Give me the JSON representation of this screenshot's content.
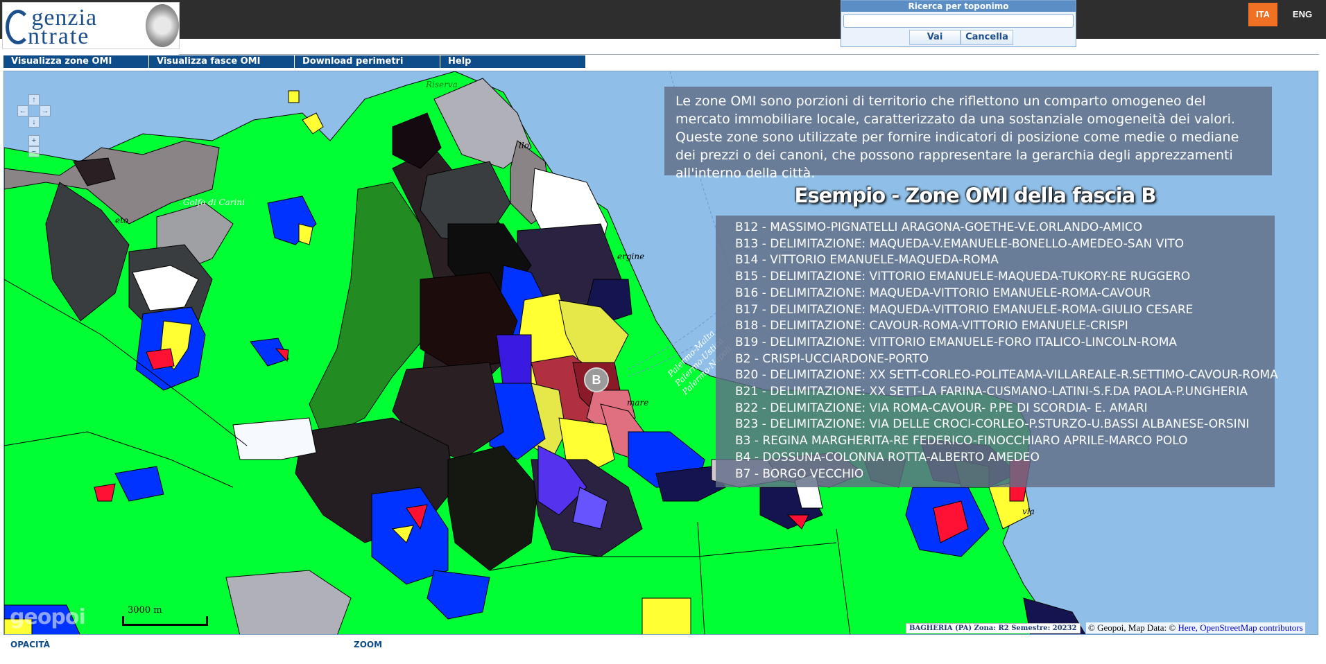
{
  "header": {
    "logo_line1": "genzia",
    "logo_line2": "ntrate",
    "logo_alt": "Agenzia Entrate"
  },
  "search": {
    "title": "Ricerca per toponimo",
    "input_value": "",
    "go_label": "Vai",
    "cancel_label": "Cancella"
  },
  "lang": {
    "ita": "ITA",
    "eng": "ENG"
  },
  "menu": [
    {
      "label": "Visualizza zone OMI"
    },
    {
      "label": "Visualizza fasce OMI"
    },
    {
      "label": "Download perimetri"
    },
    {
      "label": "Help"
    }
  ],
  "info": {
    "text": "Le zone OMI sono porzioni di territorio che riflettono un comparto omogeneo del mercato immobiliare locale, caratterizzato da una sostanziale omogeneità dei valori. Queste zone sono utilizzate per fornire indicatori di posizione come medie o mediane dei prezzi o dei canoni, che possono rappresentare la gerarchia degli apprezzamenti all'interno della città."
  },
  "example_title": "Esempio - Zone OMI della fascia B",
  "zones": [
    "B12 - MASSIMO-PIGNATELLI ARAGONA-GOETHE-V.E.ORLANDO-AMICO",
    "B13 - DELIMITAZIONE: MAQUEDA-V.EMANUELE-BONELLO-AMEDEO-SAN VITO",
    "B14 - VITTORIO EMANUELE-MAQUEDA-ROMA",
    "B15 - DELIMITAZIONE: VITTORIO EMANUELE-MAQUEDA-TUKORY-RE RUGGERO",
    "B16 - DELIMITAZIONE: MAQUEDA-VITTORIO EMANUELE-ROMA-CAVOUR",
    "B17 - DELIMITAZIONE: MAQUEDA-VITTORIO EMANUELE-ROMA-GIULIO CESARE",
    "B18 - DELIMITAZIONE: CAVOUR-ROMA-VITTORIO EMANUELE-CRISPI",
    "B19 - DELIMITAZIONE: VITTORIO EMANUELE-FORO ITALICO-LINCOLN-ROMA",
    "B2 - CRISPI-UCCIARDONE-PORTO",
    "B20 - DELIMITAZIONE: XX SETT-CORLEO-POLITEAMA-VILLAREALE-R.SETTIMO-CAVOUR-ROMA",
    "B21 - DELIMITAZIONE: XX SETT-LA FARINA-CUSMANO-LATINI-S.F.DA PAOLA-P.UNGHERIA",
    "B22 - DELIMITAZIONE: VIA ROMA-CAVOUR- P.PE DI SCORDIA- E. AMARI",
    "B23 - DELIMITAZIONE: VIA DELLE CROCI-CORLEO-P.STURZO-U.BASSI ALBANESE-ORSINI",
    "B3 - REGINA MARGHERITA-RE FEDERICO-FINOCCHIARO APRILE-MARCO POLO",
    "B4 - DOSSUNA-COLONNA ROTTA-ALBERTO AMEDEO",
    "B7 - BORGO VECCHIO"
  ],
  "map": {
    "marker_label": "B",
    "labels": {
      "golfo": "Golfo di Carini",
      "riserva": "Riserva",
      "eto": "eto",
      "ergine": "ergine",
      "mare": "mare",
      "llo": "llo",
      "via": "via",
      "palermo_malta": "Palermo-Malta",
      "palermo_ustica": "Palermo-Ustica",
      "palermo_napoli": "Palermo-Napoli"
    },
    "scale": "3000 m",
    "logo": "geopoi",
    "zone_status": "BAGHERIA (PA) Zona: R2 Semestre: 20232",
    "attribution_prefix": "© Geopoi, Map Data: ©",
    "attribution_links": "Here, OpenStreetMap contributors"
  },
  "footer": {
    "opacity": "OPACITÀ",
    "zoom": "ZOOM"
  },
  "colors": {
    "accent": "#f07024",
    "menu_bg": "#0f4d8a",
    "sea": "#8fbfe8",
    "zone_green": "#00ff33"
  }
}
